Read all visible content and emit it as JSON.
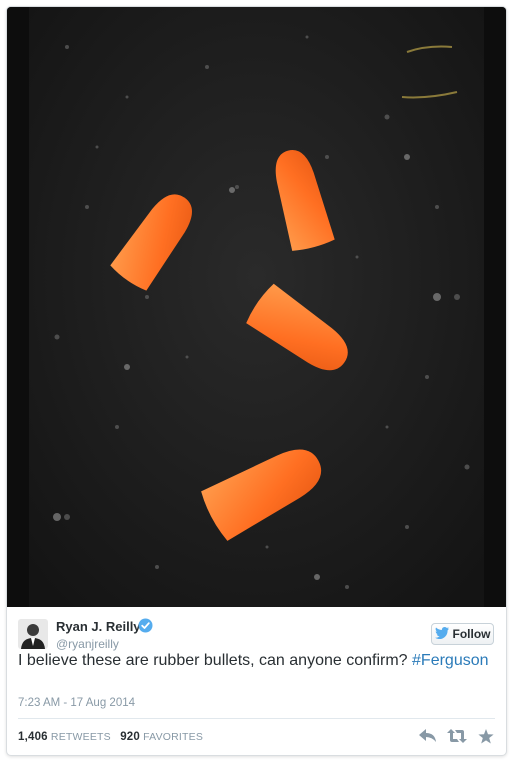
{
  "tweet": {
    "author_name": "Ryan J. Reilly",
    "author_handle": "@ryanjreilly",
    "follow_label": "Follow",
    "text": "I believe these are rubber bullets, can anyone confirm?",
    "hashtag": "#Ferguson",
    "timestamp": "7:23 AM - 17 Aug 2014",
    "retweets_count": "1,406",
    "retweets_label": "RETWEETS",
    "favorites_count": "920",
    "favorites_label": "FAVORITES"
  },
  "colors": {
    "link": "#2b7bb9",
    "verified": "#55acee",
    "earplug": "#ff7a2e"
  },
  "icons": [
    "verified-badge-icon",
    "twitter-bird-icon",
    "reply-icon",
    "retweet-icon",
    "favorite-icon"
  ]
}
